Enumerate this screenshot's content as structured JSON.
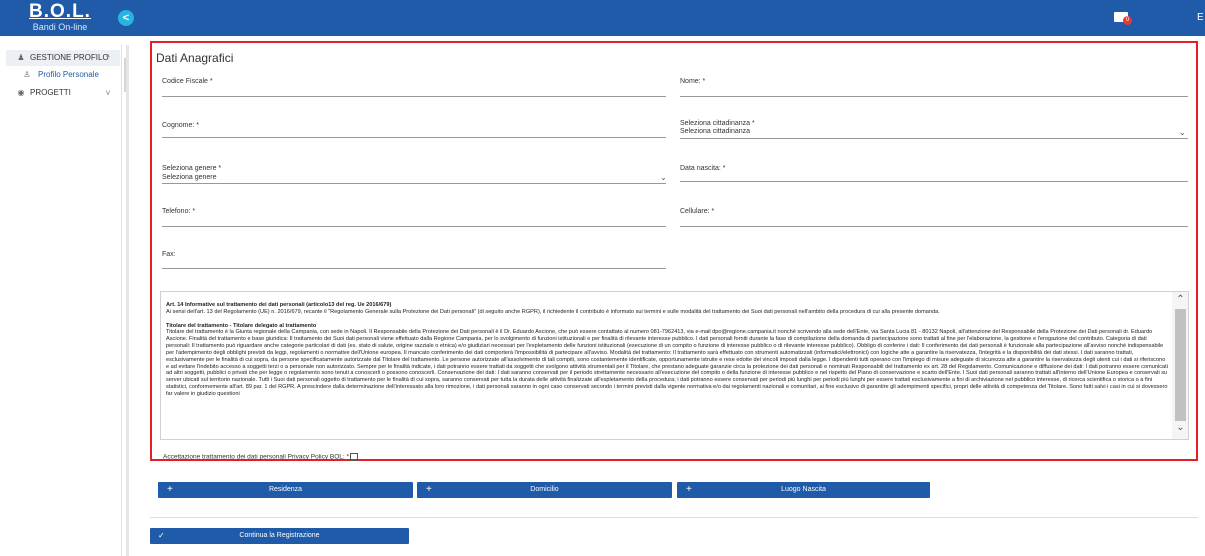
{
  "header": {
    "logo_title": "B.O.L.",
    "logo_subtitle": "Bandi On-line",
    "collapse_icon": "<",
    "mail_badge": "0",
    "right_letter": "E"
  },
  "sidebar": {
    "items": [
      {
        "label": "GESTIONE PROFILO",
        "icon": "person-icon",
        "chevron": "^"
      },
      {
        "label": "Profilo Personale",
        "icon": "people-icon"
      },
      {
        "label": "PROGETTI",
        "icon": "globe-icon",
        "chevron": "v"
      }
    ]
  },
  "form": {
    "title": "Dati Anagrafici",
    "fields": {
      "codice_fiscale": {
        "label": "Codice Fiscale *",
        "value": ""
      },
      "nome": {
        "label": "Nome: *",
        "value": ""
      },
      "cognome": {
        "label": "Cognome: *",
        "value": ""
      },
      "cittadinanza": {
        "label": "Seleziona cittadinanza *",
        "value": "Seleziona cittadinanza"
      },
      "genere": {
        "label": "Seleziona genere *",
        "value": "Seleziona genere"
      },
      "data_nascita": {
        "label": "Data nascita: *",
        "value": ""
      },
      "telefono": {
        "label": "Telefono: *",
        "value": ""
      },
      "cellulare": {
        "label": "Cellulare: *",
        "value": ""
      },
      "fax": {
        "label": "Fax:",
        "value": ""
      }
    }
  },
  "privacy": {
    "heading": "Art. 14 Informative sul trattamento dei dati personali (articolo13 del reg. Ue 2016/679)",
    "intro": "Ai sensi dell'art. 13 del Regolamento (UE) n. 2016/679, recante il \"Regolamento Generale sulla Protezione dei Dati personali\" (di seguito anche RGPR), il richiedente il contributo è informato sui termini e sulle modalità del trattamento dei Suoi dati personali nell'ambito della procedura di cui alla presente domanda.",
    "section_title": "Titolare del trattamento - Titolare delegato al trattamento",
    "body": "Titolare del trattamento è la Giunta regionale della Campania, con sede in Napoli. Il Responsabile della Protezione dei Dati personali è il Dr. Eduardo Ascione, che può essere contattato al numero 081-7962413, via e-mail dpo@regione.campania.it nonché scrivendo alla sede dell'Ente, via Santa Lucia 81 - 80132 Napoli, all'attenzione del Responsabile della Protezione dei Dati personali dr. Eduardo Ascione. Finalità del trattamento e base giuridica: Il trattamento dei Suoi dati personali viene effettuato dalla Regione Campania, per lo svolgimento di funzioni istituzionali e per finalità di rilevante interesse pubblico. I dati personali forniti durante la fase di compilazione della domanda di partecipazione sono trattati al fine per l'elaborazione, la gestione e l'erogazione del contributo. Categoria di dati personali: Il trattamento può riguardare anche categorie particolari di dati (es. stato di salute, origine razziale o etnica) e/o giudiziari necessari per l'espletamento delle funzioni istituzionali (esecuzione di un compito o funzione di interesse pubblico o di rilevante interesse pubblico). Obbligo di conferire i dati: Il conferimento dei dati personali è funzionale alla partecipazione all'avviso nonché indispensabile per l'adempimento degli obblighi previsti da leggi, regolamenti o normative dell'Unione europea. Il mancato conferimento dei dati comporterà l'impossibilità di partecipare all'avviso. Modalità del trattamento: Il trattamento sarà effettuato con strumenti automatizzati (informatici/elettronici) con logiche atte a garantire la riservatezza, l'integrità e la disponibilità dei dati stessi. I dati saranno trattati, esclusivamente per le finalità di cui sopra, da persone specificatamente autorizzate dal Titolare del trattamento. Le persone autorizzate all'assolvimento di tali compiti, sono costantemente identificate, opportunamente istruite e rese edotte dei vincoli imposti dalla legge. I dipendenti tutti operano con l'impiego di misure adeguate di sicurezza atte a garantire la riservatezza degli utenti cui i dati si riferiscono e ad evitare l'indebito accesso a soggetti terzi o a personale non autorizzato. Sempre per le finalità indicate, i dati potranno essere trattati da soggetti che svolgono attività strumentali per il Titolare, che prestano adeguate garanzie circa la protezione dei dati personali e nominati Responsabili del trattamento ex art. 28 del Regolamento. Comunicazione e diffusione dei dati: I dati potranno essere comunicati ad altri soggetti, pubblici o privati che per legge o regolamento sono tenuti a conoscerli o possono conoscerli. Conservazione dei dati: I dati saranno conservati per il periodo strettamente necessario all'esecuzione del compito o della funzione di interesse pubblico e nel rispetto del Piano di conservazione e scarto dell'Ente. I Suoi dati personali saranno trattati all'interno dell'Unione Europea e conservati su server ubicati sul territorio nazionale. Tutti i Suoi dati personali oggetto di trattamento per le finalità di cui sopra, saranno conservati per tutta la durata delle attività finalizzate all'espletamento della procedura; i dati potranno essere conservati per periodi più lunghi per periodi più lunghi per essere trattati esclusivamente a fini di archiviazione nel pubblico interesse, di ricerca scientifica o storica o a fini statistici, conformemente all'art. 89 par. 1 del RGPR. A prescindere dalla determinazione dell'interessato alla loro rimozione, i dati personali saranno in ogni caso conservati secondo i termini previsti dalla vigente normativa e/o dai regolamenti nazionali e comunitari, ai fine esclusivo di garantire gli adempimenti specifici, propri delle attività di competenza del Titolare. Sono fatti salvi i casi in cui si dovessero far valere in giudizio questioni",
    "accept_label": "Accettazione trattamento dei dati personali Privacy Policy BOL: *",
    "accept_checked": false
  },
  "buttons": {
    "residenza": "Residenza",
    "domicilio": "Domicilio",
    "luogo_nascita": "Luogo Nascita",
    "continua": "Continua la Registrazione",
    "plus_glyph": "+",
    "check_glyph": "✓"
  },
  "colors": {
    "brand": "#1f5ba8",
    "highlight_border": "#e31e24",
    "collapse_button": "#27b4e0",
    "badge": "#e53935"
  }
}
